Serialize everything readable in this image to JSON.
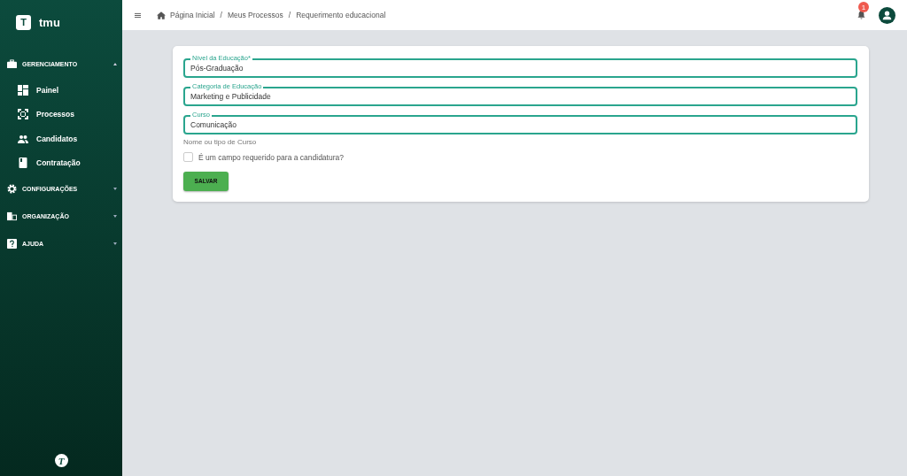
{
  "brand": {
    "logo_letter": "T",
    "name": "tmu"
  },
  "sidebar": {
    "sections": [
      {
        "label": "GERENCIAMENTO",
        "expanded": true,
        "children": [
          {
            "label": "Painel"
          },
          {
            "label": "Processos"
          },
          {
            "label": "Candidatos"
          },
          {
            "label": "Contratação"
          }
        ]
      },
      {
        "label": "CONFIGURAÇÕES",
        "expanded": false
      },
      {
        "label": "ORGANIZAÇÃO",
        "expanded": false
      },
      {
        "label": "AJUDA",
        "expanded": false
      }
    ],
    "footer_logo": "T"
  },
  "topbar": {
    "breadcrumb": [
      "Página Inicial",
      "Meus Processos",
      "Requerimento educacional"
    ],
    "separator": "/",
    "notification_count": "1"
  },
  "form": {
    "fields": [
      {
        "label": "Nível da Educação*",
        "value": "Pós-Graduação"
      },
      {
        "label": "Categoria de Educação",
        "value": "Marketing e Publicidade"
      },
      {
        "label": "Curso",
        "value": "Comunicação",
        "helper": "Nome ou tipo de Curso"
      }
    ],
    "checkbox": {
      "label": "É um campo requerido para a candidatura?",
      "checked": false
    },
    "submit": "SALVAR"
  }
}
